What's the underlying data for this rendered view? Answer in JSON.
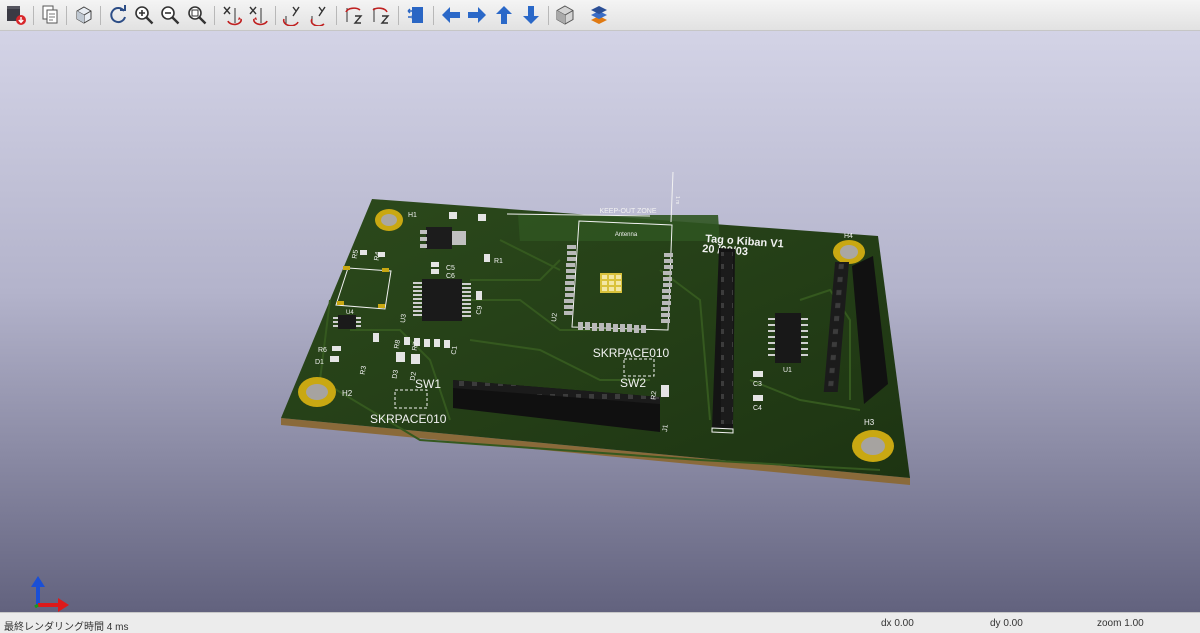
{
  "toolbar": {
    "buttons": [
      {
        "name": "render-export-icon"
      },
      {
        "name": "copy-to-clipboard-icon"
      },
      {
        "name": "raytracing-icon"
      },
      {
        "name": "reload-icon"
      },
      {
        "name": "zoom-in-icon"
      },
      {
        "name": "zoom-out-icon"
      },
      {
        "name": "zoom-fit-icon"
      },
      {
        "name": "rotate-x-cw-icon"
      },
      {
        "name": "rotate-x-ccw-icon"
      },
      {
        "name": "rotate-y-cw-icon"
      },
      {
        "name": "rotate-y-ccw-icon"
      },
      {
        "name": "rotate-z-cw-icon"
      },
      {
        "name": "rotate-z-ccw-icon"
      },
      {
        "name": "flip-board-icon"
      },
      {
        "name": "pan-left-icon"
      },
      {
        "name": "pan-right-icon"
      },
      {
        "name": "pan-up-icon"
      },
      {
        "name": "pan-down-icon"
      },
      {
        "name": "orthographic-icon"
      },
      {
        "name": "layers-icon"
      }
    ]
  },
  "board": {
    "keepout_label": "KEEP-OUT ZONE",
    "antenna_label": "Antenna",
    "dim_label": "1 m",
    "title_line1": "Tag  o Kiban V1",
    "title_line2": "20  /08/03",
    "module_ref": "U2",
    "module_value": "SKRPACE010",
    "sw1_ref": "SW1",
    "sw1_value": "SKRPACE010",
    "sw2_ref": "SW2",
    "j1_ref": "J1",
    "u1_ref": "U1",
    "u3_ref": "U3",
    "u4_ref": "U4",
    "holes": [
      "H1",
      "H2",
      "H3",
      "H4"
    ],
    "refs": {
      "r1": "R1",
      "r2": "R2",
      "r3": "R3",
      "r4": "R4",
      "r5": "R5",
      "r6": "R6",
      "r7": "R7",
      "r8": "R8",
      "c1": "C1",
      "c3": "C3",
      "c4": "C4",
      "c5": "C5",
      "c6": "C6",
      "c9": "C9",
      "d1": "D1",
      "d2": "D2",
      "d3": "D3"
    },
    "colors": {
      "soldermask": "#243f17",
      "silkscreen": "#f2f2f2",
      "copper": "#c9a812",
      "connector": "#1e1e1e"
    }
  },
  "status": {
    "render_time": "最終レンダリング時間 4 ms",
    "dx": "dx 0.00",
    "dy": "dy 0.00",
    "zoom": "zoom 1.00"
  }
}
